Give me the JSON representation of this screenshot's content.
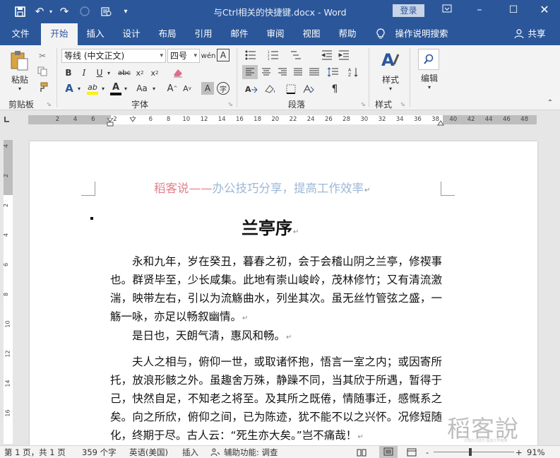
{
  "titlebar": {
    "doc_title": "与Ctrl相关的快捷键.docx  -  Word",
    "login": "登录",
    "quick_access": {
      "save": "save-icon",
      "undo": "undo-icon",
      "redo": "redo-icon",
      "touch": "touch-mode-icon",
      "customize": "customize-icon"
    }
  },
  "tabs": [
    "文件",
    "开始",
    "插入",
    "设计",
    "布局",
    "引用",
    "邮件",
    "审阅",
    "视图",
    "帮助"
  ],
  "active_tab": "开始",
  "tell_me": "操作说明搜索",
  "share": "共享",
  "ribbon": {
    "clipboard": {
      "paste": "粘贴",
      "label": "剪贴板"
    },
    "font": {
      "name": "等线 (中文正文)",
      "size": "四号",
      "label": "字体"
    },
    "paragraph": {
      "label": "段落"
    },
    "styles": {
      "button": "样式",
      "label": "样式"
    },
    "editing": {
      "button": "编辑"
    }
  },
  "ruler": {
    "ticks_left": [
      "6",
      "4",
      "2"
    ],
    "ticks": [
      "2",
      "4",
      "6",
      "8",
      "10",
      "12",
      "14",
      "16",
      "18",
      "20",
      "22",
      "24",
      "26",
      "28",
      "30",
      "32",
      "34",
      "36",
      "38",
      "40",
      "42",
      "44",
      "46",
      "48"
    ],
    "vticks": [
      "4",
      "2",
      "2",
      "4",
      "6",
      "8",
      "10",
      "12",
      "14",
      "16"
    ]
  },
  "document": {
    "header_part1": "稻客说——",
    "header_part2": "办公技巧分享，提高工作效率",
    "title": "兰亭序",
    "paragraphs": [
      "永和九年，岁在癸丑，暮春之初，会于会稽山阴之兰亭，修禊事也。群贤毕至，少长咸集。此地有崇山峻岭，茂林修竹；又有清流激湍，映带左右，引以为流觞曲水，列坐其次。虽无丝竹管弦之盛，一觞一咏，亦足以畅叙幽情。",
      "是日也，天朗气清，惠风和畅。",
      "夫人之相与，俯仰一世，或取诸怀抱，悟言一室之内；或因寄所托，放浪形骸之外。虽趣舍万殊，静躁不同，当其欣于所遇，暂得于己，快然自足，不知老之将至。及其所之既倦，情随事迁，感慨系之矣。向之所欣，俯仰之间，已为陈迹，犹不能不以之兴怀。况修短随化，终期于尽。古人云：“死生亦大矣。”岂不痛哉！"
    ],
    "para_mark": "↵"
  },
  "watermark": {
    "big": "稻客說",
    "small": "分享办公技巧 提高工作效率"
  },
  "statusbar": {
    "page": "第 1 页，共 1 页",
    "words": "359 个字",
    "language": "英语(美国)",
    "mode": "插入",
    "accessibility": "辅助功能: 调查",
    "zoom": "91%",
    "zoom_minus": "-",
    "zoom_plus": "+"
  },
  "colors": {
    "brand": "#2b579a",
    "header_red": "#e37f8a",
    "header_blue": "#9bb7d7"
  }
}
